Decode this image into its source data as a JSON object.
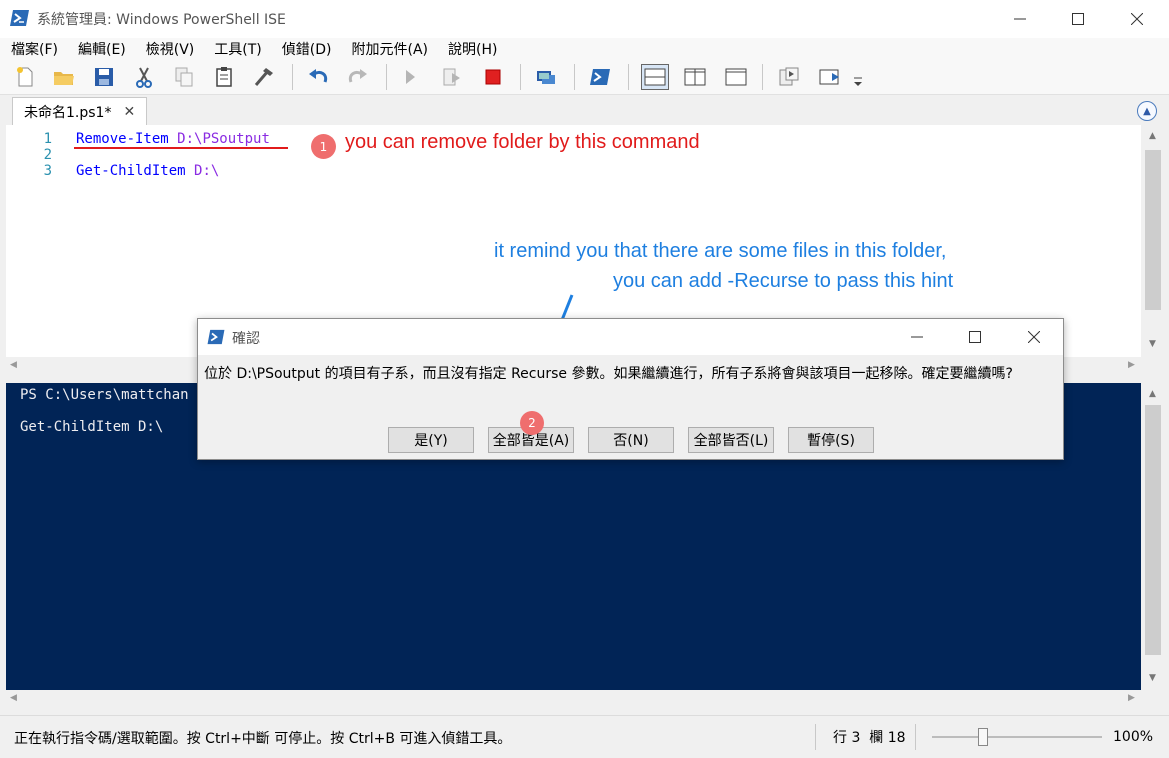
{
  "window": {
    "title": "系統管理員: Windows PowerShell ISE",
    "controls": {
      "minimize": "—",
      "maximize": "☐",
      "close": "✕"
    }
  },
  "menu": [
    "檔案(F)",
    "編輯(E)",
    "檢視(V)",
    "工具(T)",
    "偵錯(D)",
    "附加元件(A)",
    "說明(H)"
  ],
  "toolbar_icons": [
    "new-file-icon",
    "open-folder-icon",
    "save-icon",
    "cut-icon",
    "copy-icon",
    "paste-icon",
    "clear-icon",
    "undo-icon",
    "redo-icon",
    "run-icon",
    "run-selection-icon",
    "stop-icon",
    "remote-powershell-icon",
    "powershell-icon",
    "layout-top-icon",
    "layout-right-icon",
    "layout-max-icon",
    "show-command-icon",
    "show-addon-icon",
    "more-icon"
  ],
  "tab": {
    "label": "未命名1.ps1*",
    "close": "✕"
  },
  "editor": {
    "lines": [
      {
        "number": "1",
        "cmdlet": "Remove-Item",
        "arg": "D:\\PSoutput"
      },
      {
        "number": "2",
        "cmdlet": "",
        "arg": ""
      },
      {
        "number": "3",
        "cmdlet": "Get-ChildItem",
        "arg": "D:\\"
      }
    ]
  },
  "annotations": {
    "note1_badge": "1",
    "note1": "you can remove folder by this command",
    "note2_line1": "it remind you that there are some files in this folder,",
    "note2_line2": "you can add -Recurse to pass this hint",
    "note3_badge": "2"
  },
  "console": {
    "lines": [
      "PS C:\\Users\\mattchan",
      "Get-ChildItem D:\\"
    ]
  },
  "dialog": {
    "title": "確認",
    "message": "位於 D:\\PSoutput 的項目有子系，而且沒有指定 Recurse 參數。如果繼續進行，所有子系將會與該項目一起移除。確定要繼續嗎?",
    "buttons": [
      "是(Y)",
      "全部皆是(A)",
      "否(N)",
      "全部皆否(L)",
      "暫停(S)"
    ]
  },
  "status": {
    "message": "正在執行指令碼/選取範圍。按 Ctrl+中斷 可停止。按 Ctrl+B 可進入偵錯工具。",
    "line_label": "行 3",
    "col_label": "欄 18",
    "zoom": "100%",
    "zoom_level": 0.3
  },
  "colors": {
    "console_bg": "#012456",
    "annotation_red": "#e11b1b",
    "annotation_blue": "#1e7fe0"
  }
}
